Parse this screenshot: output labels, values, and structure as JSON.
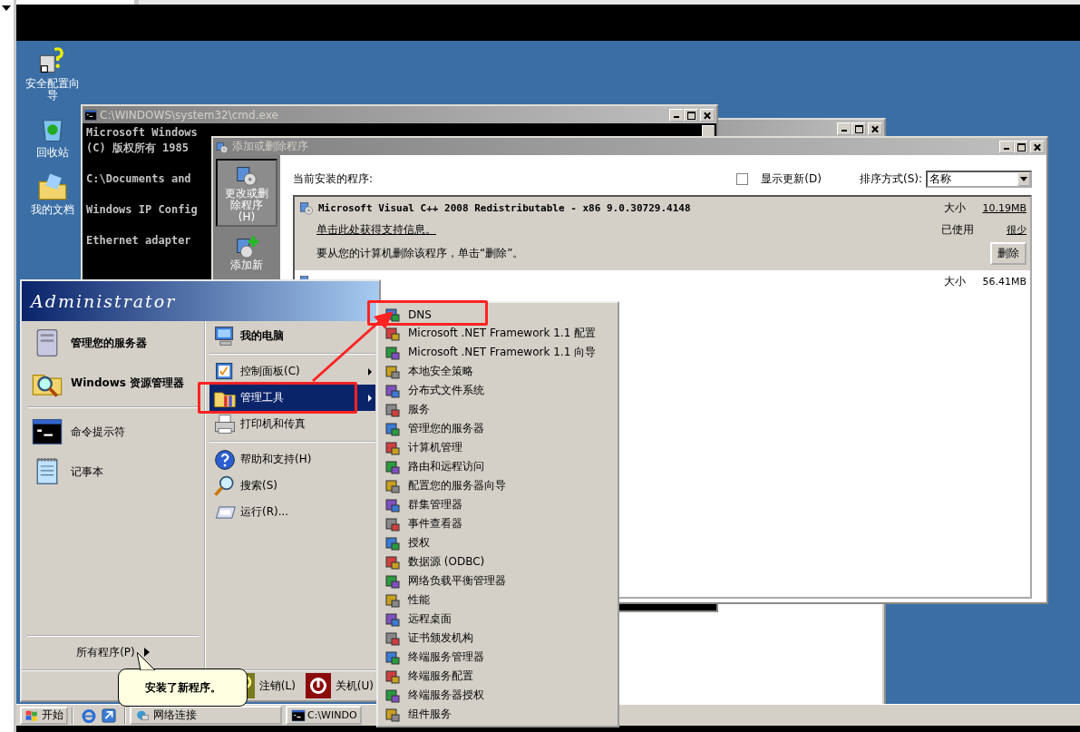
{
  "desktop_icons": [
    {
      "label": "安全配置向导"
    },
    {
      "label": "回收站"
    },
    {
      "label": "我的文档"
    }
  ],
  "cmd_window": {
    "title": "C:\\WINDOWS\\system32\\cmd.exe",
    "blocks": [
      [
        "Microsoft Windows",
        "(C) 版权所有 1985"
      ],
      [
        "C:\\Documents and"
      ],
      [
        "Windows IP Config"
      ],
      [
        "Ethernet adapter"
      ]
    ]
  },
  "add_remove_window": {
    "title": "添加或删除程序",
    "sidebar": [
      {
        "label": "更改或删除程序(H)",
        "selected": true
      },
      {
        "label": "添加新",
        "selected": false
      }
    ],
    "heading": "当前安装的程序:",
    "show_updates": {
      "label": "显示更新(D)",
      "checked": false
    },
    "sort": {
      "label": "排序方式(S):",
      "value": "名称"
    },
    "programs": [
      {
        "name": "Microsoft Visual C++ 2008 Redistributable - x86 9.0.30729.4148",
        "selected": true,
        "size_label": "大小",
        "size": "10.19MB",
        "support_link": "单击此处获得支持信息。",
        "used_label": "已使用",
        "used": "很少",
        "remove_hint": "要从您的计算机删除该程序，单击“删除”。",
        "remove_button": "删除"
      },
      {
        "selected": false,
        "size_label": "大小",
        "size": "56.41MB"
      }
    ]
  },
  "start_menu": {
    "user": "Administrator",
    "pinned": [
      {
        "label": "管理您的服务器"
      },
      {
        "label": "Windows 资源管理器"
      }
    ],
    "recent": [
      {
        "label": "命令提示符"
      },
      {
        "label": "记事本"
      }
    ],
    "all_programs": "所有程序(P)",
    "right_items": [
      {
        "kind": "item",
        "label": "我的电脑",
        "bold": true,
        "submenu": false,
        "selected": false
      },
      {
        "kind": "separator"
      },
      {
        "kind": "item",
        "label": "控制面板(C)",
        "bold": false,
        "submenu": true,
        "selected": false
      },
      {
        "kind": "item",
        "label": "管理工具",
        "bold": false,
        "submenu": true,
        "selected": true
      },
      {
        "kind": "item",
        "label": "打印机和传真",
        "bold": false,
        "submenu": false,
        "selected": false
      },
      {
        "kind": "separator"
      },
      {
        "kind": "item",
        "label": "帮助和支持(H)",
        "bold": false,
        "submenu": false,
        "selected": false
      },
      {
        "kind": "item",
        "label": "搜索(S)",
        "bold": false,
        "submenu": false,
        "selected": false
      },
      {
        "kind": "item",
        "label": "运行(R)...",
        "bold": false,
        "submenu": false,
        "selected": false
      }
    ],
    "footer": [
      {
        "kind": "logoff",
        "label": "注销(L)"
      },
      {
        "kind": "shutdown",
        "label": "关机(U)"
      }
    ],
    "balloon": "安装了新程序。"
  },
  "admin_tools_menu": [
    "DNS",
    "Microsoft .NET Framework 1.1 配置",
    "Microsoft .NET Framework 1.1 向导",
    "本地安全策略",
    "分布式文件系统",
    "服务",
    "管理您的服务器",
    "计算机管理",
    "路由和远程访问",
    "配置您的服务器向导",
    "群集管理器",
    "事件查看器",
    "授权",
    "数据源 (ODBC)",
    "网络负载平衡管理器",
    "性能",
    "远程桌面",
    "证书颁发机构",
    "终端服务管理器",
    "终端服务配置",
    "终端服务器授权",
    "组件服务"
  ],
  "taskbar": {
    "start": "开始",
    "tasks": [
      {
        "label": "网络连接"
      },
      {
        "label": "C:\\WINDO"
      }
    ]
  }
}
